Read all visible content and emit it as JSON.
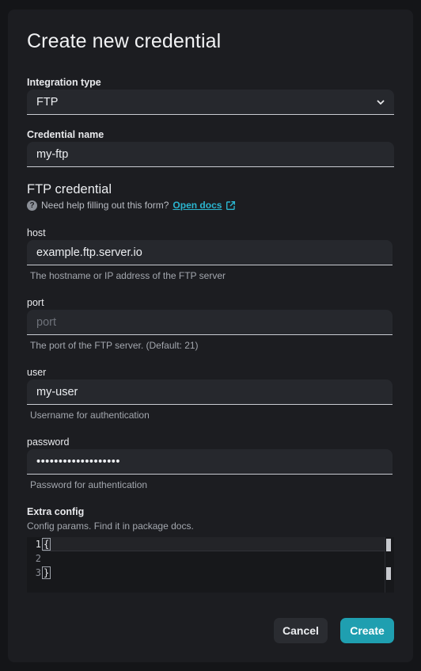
{
  "dialog": {
    "title": "Create new credential"
  },
  "integration_type": {
    "label": "Integration type",
    "value": "FTP"
  },
  "credential_name": {
    "label": "Credential name",
    "value": "my-ftp"
  },
  "ftp_section": {
    "heading": "FTP credential",
    "help_text": "Need help filling out this form?",
    "docs_link": "Open docs"
  },
  "host": {
    "label": "host",
    "value": "example.ftp.server.io",
    "help": "The hostname or IP address of the FTP server"
  },
  "port": {
    "label": "port",
    "placeholder": "port",
    "help": "The port of the FTP server. (Default: 21)"
  },
  "user": {
    "label": "user",
    "value": "my-user",
    "help": "Username for authentication"
  },
  "password": {
    "label": "password",
    "value": "•••••••••••••••••••",
    "help": "Password for authentication"
  },
  "extra_config": {
    "label": "Extra config",
    "description": "Config params. Find it in package docs.",
    "line_numbers": [
      "1",
      "2",
      "3"
    ],
    "lines": [
      "{",
      "",
      "}"
    ]
  },
  "actions": {
    "cancel": "Cancel",
    "create": "Create"
  },
  "colors": {
    "accent": "#1f9fb0",
    "link": "#2bb5cf"
  },
  "icons": {
    "dropdown": "chevron-down-icon",
    "help": "question-circle-icon",
    "external": "external-link-icon"
  }
}
